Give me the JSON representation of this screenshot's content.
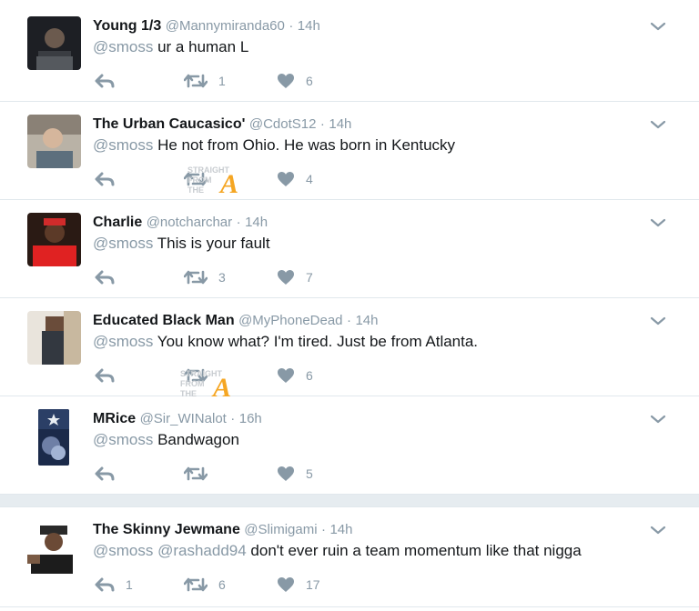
{
  "colors": {
    "accent": "#8899a6",
    "text": "#14171a",
    "watermark": "#f5a623"
  },
  "tweets": [
    {
      "name": "Young 1/3",
      "handle": "@Mannymiranda60",
      "sep": "·",
      "time": "14h",
      "mentions": "@smoss",
      "body": " ur a human L",
      "reply_count": "",
      "retweet_count": "1",
      "like_count": "6"
    },
    {
      "name": "The Urban Caucasico'",
      "handle": "@CdotS12",
      "sep": "·",
      "time": "14h",
      "mentions": "@smoss",
      "body": " He not from Ohio. He was born in Kentucky",
      "reply_count": "",
      "retweet_count": "",
      "like_count": "4"
    },
    {
      "name": "Charlie",
      "handle": "@notcharchar",
      "sep": "·",
      "time": "14h",
      "mentions": "@smoss",
      "body": " This is your fault",
      "reply_count": "",
      "retweet_count": "3",
      "like_count": "7"
    },
    {
      "name": "Educated Black Man",
      "handle": "@MyPhoneDead",
      "sep": "·",
      "time": "14h",
      "mentions": "@smoss",
      "body": " You know what? I'm tired. Just be from Atlanta.",
      "reply_count": "",
      "retweet_count": "",
      "like_count": "6"
    },
    {
      "name": "MRice",
      "handle": "@Sir_WINalot",
      "sep": "·",
      "time": "16h",
      "mentions": "@smoss",
      "body": " Bandwagon",
      "reply_count": "",
      "retweet_count": "",
      "like_count": "5"
    },
    {
      "name": "The Skinny Jewmane",
      "handle": "@Slimigami",
      "sep": "·",
      "time": "14h",
      "mentions": "@smoss @rashadd94",
      "body": " don't ever ruin a team momentum like that nigga",
      "reply_count": "1",
      "retweet_count": "6",
      "like_count": "17"
    }
  ],
  "watermark": {
    "line1": "STRAIGHT",
    "line2": "FROM",
    "line3": "THE",
    "letter": "A"
  }
}
